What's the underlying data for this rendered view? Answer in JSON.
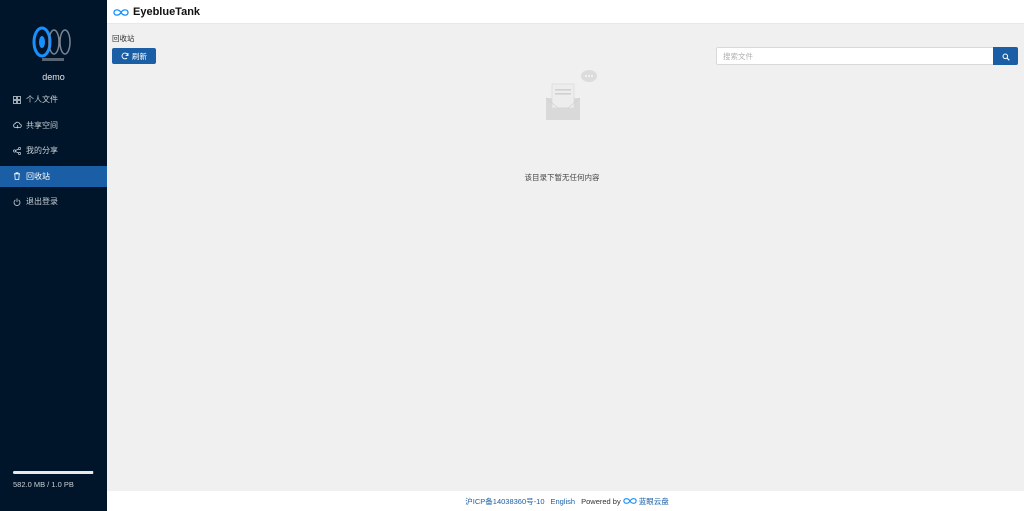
{
  "sidebar": {
    "username": "demo",
    "items": [
      {
        "label": "个人文件",
        "icon": "grid-icon",
        "active": false
      },
      {
        "label": "共享空间",
        "icon": "cloud-icon",
        "active": false
      },
      {
        "label": "我的分享",
        "icon": "share-icon",
        "active": false
      },
      {
        "label": "回收站",
        "icon": "trash-icon",
        "active": true
      },
      {
        "label": "退出登录",
        "icon": "power-icon",
        "active": false
      }
    ],
    "storage": {
      "text": "582.0 MB / 1.0 PB",
      "fraction": 0.99
    }
  },
  "header": {
    "brand": "EyeblueTank"
  },
  "main": {
    "breadcrumb": "回收站",
    "refresh_label": "刷新",
    "search_placeholder": "搜索文件",
    "empty_text": "该目录下暂无任何内容"
  },
  "footer": {
    "icp": "沪ICP备14038360号-10",
    "lang": "English",
    "powered_by": "Powered by",
    "powered_name": "蓝眼云盘"
  },
  "colors": {
    "sidebar_bg": "#001529",
    "accent": "#1a5fa6",
    "content_bg": "#f0f0f0"
  }
}
